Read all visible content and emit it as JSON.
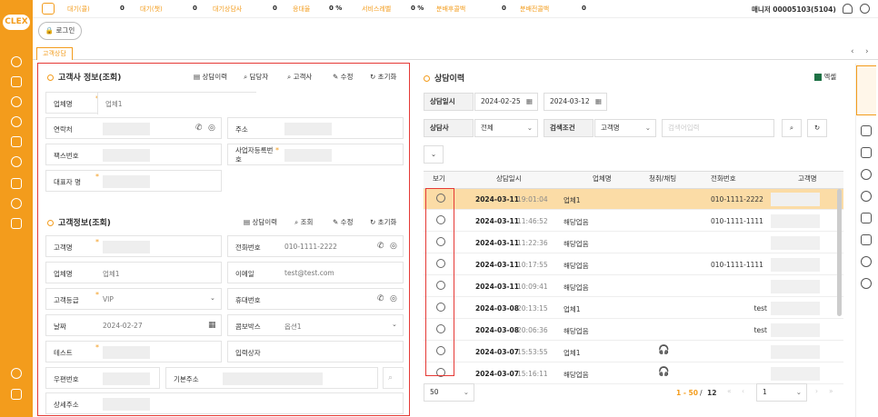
{
  "brand": {
    "logo": "CLEX"
  },
  "header": {
    "stats": [
      {
        "label": "대기(콜)",
        "value": "0"
      },
      {
        "label": "대기(챗)",
        "value": "0"
      },
      {
        "label": "대기상담사",
        "value": "0"
      },
      {
        "label": "응대율",
        "value": "0 %"
      },
      {
        "label": "서비스레벨",
        "value": "0 %"
      },
      {
        "label": "분배후콜백",
        "value": "0"
      },
      {
        "label": "분배전콜백",
        "value": "0"
      }
    ],
    "manager": "매니저 00005103(5104)"
  },
  "login_button": "로그인",
  "tab": {
    "label": "고객상담"
  },
  "company_panel": {
    "title": "고객사 정보(조회)",
    "actions": [
      "상담이력",
      "담당자",
      "고객사",
      "수정",
      "초기화"
    ],
    "fields": {
      "company_name": {
        "label": "업체명",
        "value": "업체1"
      },
      "contact": {
        "label": "연락처"
      },
      "address": {
        "label": "주소"
      },
      "fax": {
        "label": "팩스번호"
      },
      "biz_no": {
        "label": "사업자등록번\n호"
      },
      "ceo": {
        "label": "대표자 명"
      }
    }
  },
  "customer_panel": {
    "title": "고객정보(조회)",
    "actions": [
      "상담이력",
      "조회",
      "수정",
      "초기화"
    ],
    "fields": {
      "customer_name": {
        "label": "고객명"
      },
      "phone": {
        "label": "전화번호",
        "value": "010-1111-2222"
      },
      "company": {
        "label": "업체명",
        "value": "업체1"
      },
      "email": {
        "label": "이메일",
        "value": "test@test.com"
      },
      "grade": {
        "label": "고객등급",
        "value": "VIP"
      },
      "mobile": {
        "label": "휴대번호"
      },
      "date": {
        "label": "날짜",
        "value": "2024-02-27"
      },
      "combobox": {
        "label": "콤보박스",
        "value": "옵션1"
      },
      "test": {
        "label": "테스트"
      },
      "input_person": {
        "label": "입력상자"
      },
      "zip": {
        "label": "우편번호"
      },
      "base_addr": {
        "label": "기본주소"
      },
      "detail_addr": {
        "label": "상세주소"
      }
    }
  },
  "history_panel": {
    "title": "상담이력",
    "excel": "엑셀",
    "filters": {
      "date_label": "상담일시",
      "from": "2024-02-25",
      "to": "2024-03-12",
      "agent_label": "상담사",
      "agent_value": "전체",
      "cond_label": "검색조건",
      "cond_value": "고객명",
      "search_placeholder": "검색어입력"
    },
    "columns": [
      "보기",
      "상담일시",
      "업체명",
      "청취/채팅",
      "전화번호",
      "고객명"
    ],
    "rows": [
      {
        "date": "2024-03-11",
        "time": "19:01:04",
        "company": "업체1",
        "phone": "010-1111-2222",
        "customer": "",
        "listen": false
      },
      {
        "date": "2024-03-11",
        "time": "11:46:52",
        "company": "해당업음",
        "phone": "010-1111-1111",
        "customer": "",
        "listen": false
      },
      {
        "date": "2024-03-11",
        "time": "11:22:36",
        "company": "해당업음",
        "phone": "",
        "customer": "",
        "listen": false
      },
      {
        "date": "2024-03-11",
        "time": "10:17:55",
        "company": "해당업음",
        "phone": "010-1111-1111",
        "customer": "",
        "listen": false
      },
      {
        "date": "2024-03-11",
        "time": "10:09:41",
        "company": "해당업음",
        "phone": "",
        "customer": "",
        "listen": false
      },
      {
        "date": "2024-03-08",
        "time": "20:13:15",
        "company": "업체1",
        "phone": "",
        "customer": "test",
        "listen": false
      },
      {
        "date": "2024-03-08",
        "time": "20:06:36",
        "company": "해당업음",
        "phone": "",
        "customer": "test",
        "listen": false
      },
      {
        "date": "2024-03-07",
        "time": "15:53:55",
        "company": "업체1",
        "phone": "",
        "customer": "",
        "listen": true
      },
      {
        "date": "2024-03-07",
        "time": "15:16:11",
        "company": "해당업음",
        "phone": "",
        "customer": "",
        "listen": true
      }
    ],
    "page_size": "50",
    "range": "1 - 50",
    "separator": "/",
    "total": "12",
    "page": "1"
  },
  "colors": {
    "accent": "#f39c1c",
    "highlight": "#fbdca6",
    "annotation": "#e53935"
  }
}
